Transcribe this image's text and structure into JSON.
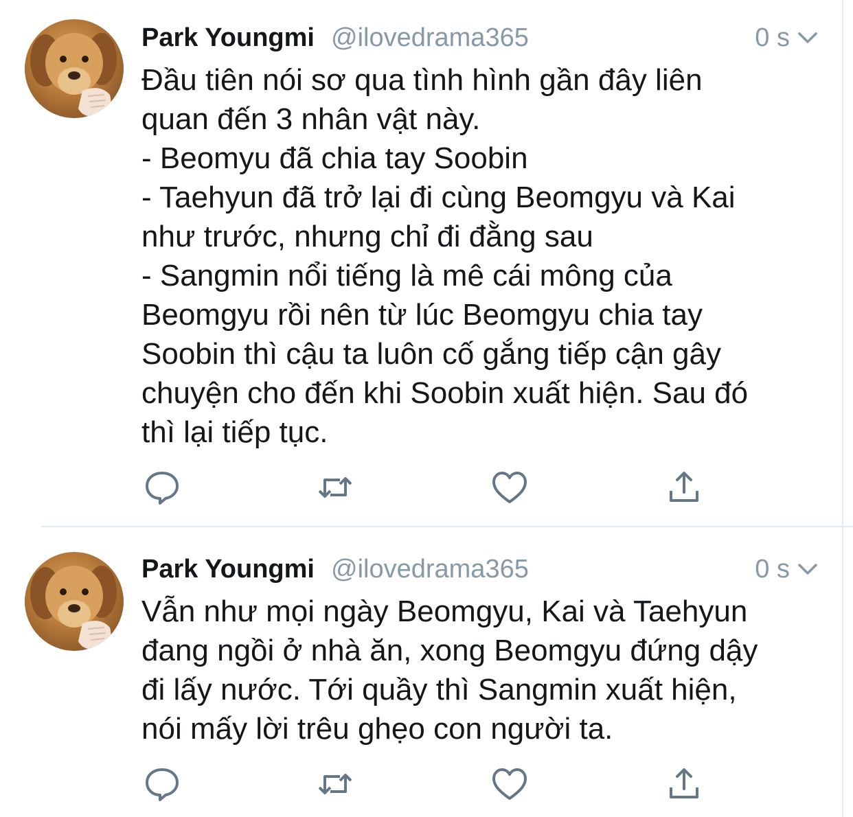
{
  "tweets": [
    {
      "name": "Park Youngmi",
      "handle": "@ilovedrama365",
      "time": "0 s",
      "text": "Đầu tiên nói sơ qua tình hình gần đây liên\nquan đến 3 nhân vật này.\n- Beomyu đã chia tay Soobin\n- Taehyun đã trở lại đi cùng Beomgyu và Kai\nnhư trước, nhưng chỉ đi đằng sau\n- Sangmin nổi tiếng là mê cái mông của\nBeomgyu rồi nên từ lúc Beomgyu chia tay\nSoobin thì cậu ta luôn cố gắng tiếp cận gây\nchuyện cho đến khi Soobin xuất hiện. Sau đó\nthì lại tiếp tục."
    },
    {
      "name": "Park Youngmi",
      "handle": "@ilovedrama365",
      "time": "0 s",
      "text": "Vẫn như mọi ngày Beomgyu, Kai và Taehyun\nđang ngồi ở nhà ăn, xong Beomgyu đứng dậy\nđi lấy nước. Tới quầy thì Sangmin xuất hiện,\nnói mấy lời trêu ghẹo con người ta."
    }
  ],
  "icons": {
    "reply": "reply-icon",
    "retweet": "retweet-icon",
    "like": "heart-icon",
    "share": "share-icon",
    "menu": "chevron-down-icon"
  },
  "colors": {
    "text": "#14171a",
    "muted": "#8899a6",
    "icon": "#657786",
    "divider": "#e1e8ed"
  }
}
